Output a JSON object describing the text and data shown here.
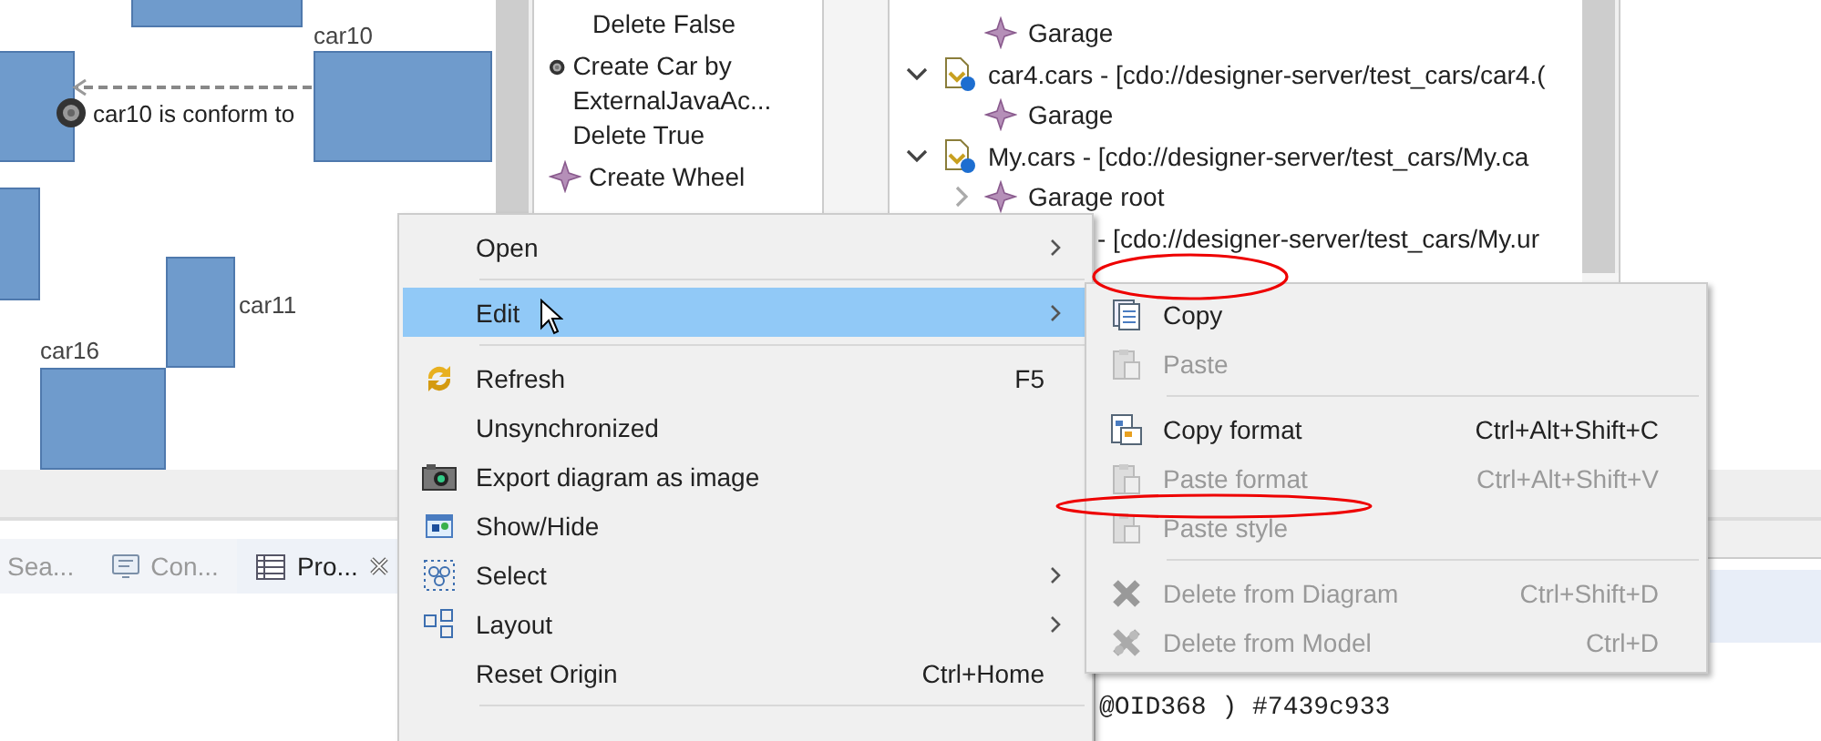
{
  "diagram": {
    "nodes": [
      {
        "label": "car10"
      },
      {
        "label": "car11"
      },
      {
        "label": "car16"
      }
    ],
    "edge_label": "car10 is conform to"
  },
  "palette": {
    "tools": [
      {
        "kind": "text",
        "label": "Delete False"
      },
      {
        "kind": "wheel",
        "label": "Create Car by ExternalJavaAc... Delete True"
      },
      {
        "kind": "star",
        "label": "Create Wheel"
      }
    ]
  },
  "tree": {
    "items": [
      {
        "kind": "element",
        "label": "Garage"
      },
      {
        "kind": "resource",
        "label": "car4.cars - [cdo://designer-server/test_cars/car4.(",
        "expanded": true,
        "children": [
          {
            "kind": "element",
            "label": "Garage"
          }
        ]
      },
      {
        "kind": "resource",
        "label": "My.cars - [cdo://designer-server/test_cars/My.ca",
        "expanded": true,
        "children": [
          {
            "kind": "element",
            "label": "Garage root",
            "expanded": false
          }
        ]
      },
      {
        "kind": "continuation",
        "label": "- [cdo://designer-server/test_cars/My.ur"
      }
    ]
  },
  "bottom_tabs": [
    {
      "label": "Sea...",
      "selected": false
    },
    {
      "label": "Con...",
      "selected": false
    },
    {
      "label": "Pro...",
      "selected": true
    }
  ],
  "properties_text": "@OID368 ) #7439c933",
  "context_menu": {
    "items": [
      {
        "kind": "item",
        "label": "Open",
        "submenu": true,
        "selected": false
      },
      {
        "kind": "separator"
      },
      {
        "kind": "item",
        "label": "Edit",
        "submenu": true,
        "selected": true
      },
      {
        "kind": "separator"
      },
      {
        "kind": "item",
        "label": "Refresh",
        "shortcut": "F5",
        "submenu": false,
        "selected": false
      },
      {
        "kind": "item",
        "label": "Unsynchronized",
        "submenu": false,
        "selected": false
      },
      {
        "kind": "item",
        "label": "Export diagram as image",
        "submenu": false,
        "selected": false
      },
      {
        "kind": "item",
        "label": "Show/Hide",
        "submenu": false,
        "selected": false
      },
      {
        "kind": "item",
        "label": "Select",
        "submenu": true,
        "selected": false
      },
      {
        "kind": "item",
        "label": "Layout",
        "submenu": true,
        "selected": false
      },
      {
        "kind": "item",
        "label": "Reset Origin",
        "shortcut": "Ctrl+Home",
        "submenu": false,
        "selected": false
      },
      {
        "kind": "separator"
      }
    ]
  },
  "edit_submenu": {
    "items": [
      {
        "kind": "item",
        "label": "Copy",
        "disabled": false
      },
      {
        "kind": "item",
        "label": "Paste",
        "disabled": true
      },
      {
        "kind": "separator"
      },
      {
        "kind": "item",
        "label": "Copy format",
        "shortcut": "Ctrl+Alt+Shift+C",
        "disabled": false
      },
      {
        "kind": "item",
        "label": "Paste format",
        "shortcut": "Ctrl+Alt+Shift+V",
        "disabled": true
      },
      {
        "kind": "item",
        "label": "Paste style",
        "disabled": true
      },
      {
        "kind": "separator"
      },
      {
        "kind": "item",
        "label": "Delete from Diagram",
        "shortcut": "Ctrl+Shift+D",
        "disabled": true
      },
      {
        "kind": "item",
        "label": "Delete from Model",
        "shortcut": "Ctrl+D",
        "disabled": true
      }
    ]
  }
}
